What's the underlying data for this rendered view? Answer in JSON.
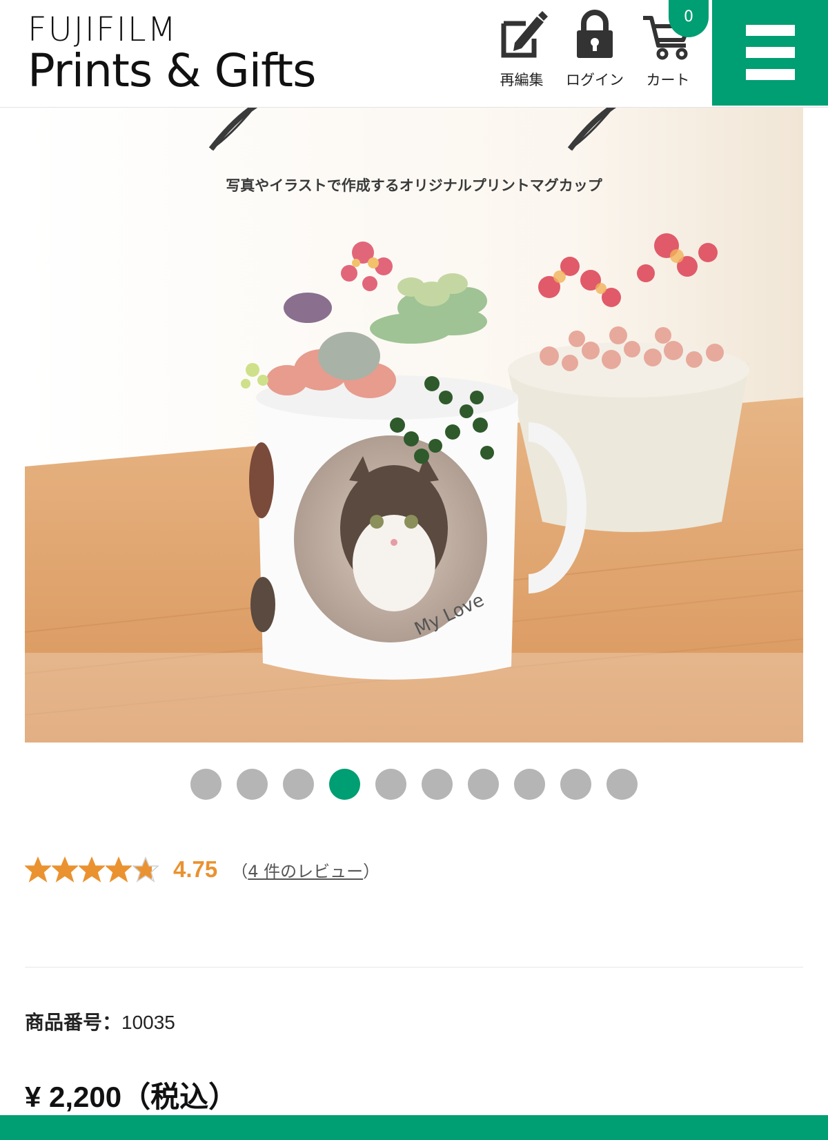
{
  "header": {
    "logo_line1": "FUJIFILM",
    "logo_line2": "Prints & Gifts",
    "edit_label": "再編集",
    "login_label": "ログイン",
    "cart_label": "カート",
    "cart_count": "0",
    "icons": {
      "edit": "pencil-square-icon",
      "login": "lock-icon",
      "cart": "cart-icon",
      "menu": "hamburger-menu-icon"
    }
  },
  "hero": {
    "caption": "写真やイラストで作成するオリジナルプリントマグカップ",
    "mug_text": "My Love"
  },
  "carousel": {
    "total": 10,
    "active_index": 3
  },
  "rating": {
    "value": "4.75",
    "stars_fraction": 0.95,
    "review_open": "（",
    "review_text": "4 件のレビュー",
    "review_close": "）"
  },
  "product": {
    "number_label": "商品番号：",
    "number": "10035",
    "price": "¥ 2,200（税込）"
  },
  "colors": {
    "brand_green": "#009e73",
    "rating_orange": "#ea9230",
    "dot_gray": "#b5b5b5"
  }
}
